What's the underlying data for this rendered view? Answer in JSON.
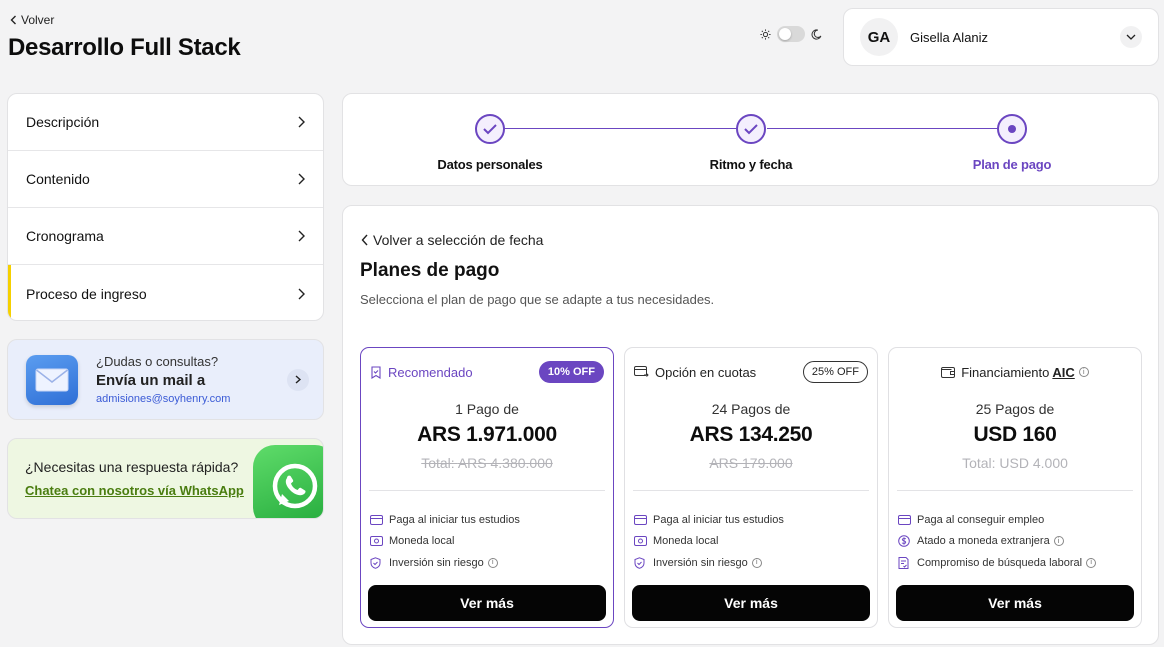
{
  "header": {
    "back_label": "Volver",
    "title": "Desarrollo Full Stack"
  },
  "theme_toggle": {
    "light_icon": "sun-icon",
    "dark_icon": "moon-icon"
  },
  "user": {
    "initials": "GA",
    "name": "Gisella Alaniz"
  },
  "sidebar": {
    "items": [
      {
        "label": "Descripción"
      },
      {
        "label": "Contenido"
      },
      {
        "label": "Cronograma"
      },
      {
        "label": "Proceso de ingreso"
      }
    ]
  },
  "mail_card": {
    "question": "¿Dudas o consultas?",
    "title": "Envía un mail a",
    "address": "admisiones@soyhenry.com"
  },
  "whatsapp_card": {
    "question": "¿Necesitas una respuesta rápida?",
    "link": "Chatea con nosotros vía WhatsApp"
  },
  "stepper": {
    "steps": [
      {
        "label": "Datos personales",
        "status": "done"
      },
      {
        "label": "Ritmo y fecha",
        "status": "done"
      },
      {
        "label": "Plan de pago",
        "status": "current"
      }
    ]
  },
  "plans_section": {
    "back_label": "Volver a selección de fecha",
    "title": "Planes de pago",
    "subtitle": "Selecciona el plan de pago que se adapte a tus necesidades."
  },
  "plans": [
    {
      "header": "Recomendado",
      "badge": "10% OFF",
      "count": "1 Pago de",
      "price": "ARS 1.971.000",
      "total_prefix": "Total: ",
      "total_value": "ARS 4.380.000",
      "features": [
        "Paga al iniciar tus estudios",
        "Moneda local",
        "Inversión sin riesgo"
      ],
      "button": "Ver más"
    },
    {
      "header": "Opción en cuotas",
      "badge": "25% OFF",
      "count": "24 Pagos de",
      "price": "ARS 134.250",
      "total_prefix": "",
      "total_value": "ARS 179.000",
      "features": [
        "Paga al iniciar tus estudios",
        "Moneda local",
        "Inversión sin riesgo"
      ],
      "button": "Ver más"
    },
    {
      "header": "Financiamiento",
      "header_link": "AIC",
      "count": "25 Pagos de",
      "price": "USD 160",
      "total_text": "Total: USD 4.000",
      "features": [
        "Paga al conseguir empleo",
        "Atado a moneda extranjera",
        "Compromiso de búsqueda laboral"
      ],
      "button": "Ver más"
    }
  ],
  "colors": {
    "accent": "#6b46c1",
    "highlight": "#f5d000",
    "button": "#050505"
  }
}
